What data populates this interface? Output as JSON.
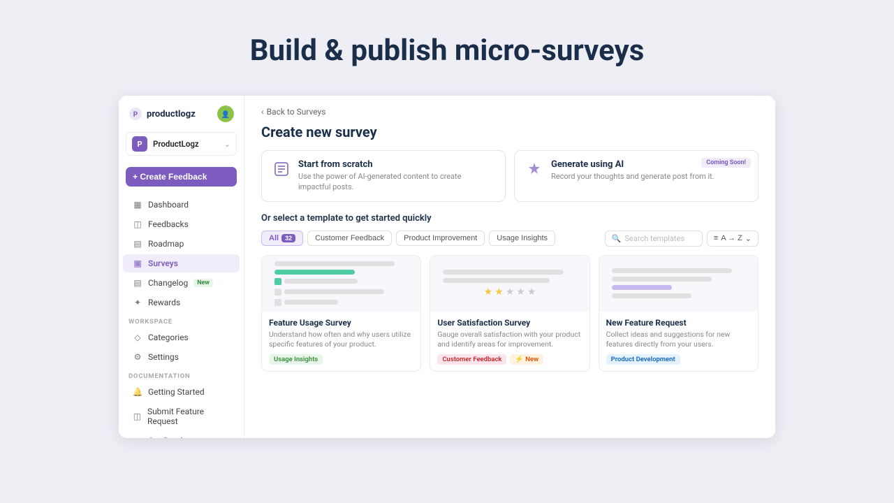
{
  "hero": {
    "title": "Build & publish micro-surveys"
  },
  "sidebar": {
    "logo_text": "productlogz",
    "workspace_name": "ProductLogz",
    "create_button": "+ Create Feedback",
    "nav_items": [
      {
        "id": "dashboard",
        "label": "Dashboard",
        "icon": "▦"
      },
      {
        "id": "feedbacks",
        "label": "Feedbacks",
        "icon": "◫"
      },
      {
        "id": "roadmap",
        "label": "Roadmap",
        "icon": "▤"
      },
      {
        "id": "surveys",
        "label": "Surveys",
        "icon": "▣",
        "active": true
      },
      {
        "id": "changelog",
        "label": "Changelog",
        "icon": "▤",
        "badge": "New"
      },
      {
        "id": "rewards",
        "label": "Rewards",
        "icon": "✦"
      }
    ],
    "workspace_section": "WORKSPACE",
    "workspace_items": [
      {
        "id": "categories",
        "label": "Categories",
        "icon": "◇"
      },
      {
        "id": "settings",
        "label": "Settings",
        "icon": "⚙"
      }
    ],
    "docs_section": "DOCUMENTATION",
    "docs_items": [
      {
        "id": "getting-started",
        "label": "Getting Started",
        "icon": "🔔"
      },
      {
        "id": "submit-feature",
        "label": "Submit Feature Request",
        "icon": "◫"
      },
      {
        "id": "our-roadmap",
        "label": "Our Roadmap",
        "icon": "◫"
      }
    ]
  },
  "main": {
    "back_link": "Back to Surveys",
    "page_title": "Create new survey",
    "options": [
      {
        "id": "scratch",
        "icon": "✏️",
        "title": "Start from scratch",
        "desc": "Use the power of AI-generated content to create impactful posts.",
        "coming_soon": false
      },
      {
        "id": "ai",
        "icon": "✦",
        "title": "Generate using AI",
        "desc": "Record your thoughts and generate post from it.",
        "coming_soon": true,
        "coming_soon_label": "Coming Soon!"
      }
    ],
    "template_section_title": "Or select a template to get started quickly",
    "filters": [
      {
        "id": "all",
        "label": "All",
        "count": "32",
        "active": true
      },
      {
        "id": "customer",
        "label": "Customer Feedback",
        "active": false
      },
      {
        "id": "product",
        "label": "Product Improvement",
        "active": false
      },
      {
        "id": "usage",
        "label": "Usage Insights",
        "active": false
      }
    ],
    "search_placeholder": "Search templates",
    "sort_label": "A → Z",
    "templates": [
      {
        "id": "feature-usage",
        "name": "Feature Usage Survey",
        "desc": "Understand how often and why users utilize specific features of your product.",
        "tag": "Usage Insights",
        "tag_type": "usage",
        "preview_type": "bars_accent"
      },
      {
        "id": "user-satisfaction",
        "name": "User Satisfaction Survey",
        "desc": "Gauge overall satisfaction with your product and identify areas for improvement.",
        "tag": "Customer Feedback",
        "tag_type": "feedback",
        "tag2": "New",
        "tag2_type": "new",
        "preview_type": "stars"
      },
      {
        "id": "new-feature",
        "name": "New Feature Request",
        "desc": "Collect ideas and suggestions for new features directly from your users.",
        "tag": "Product Development",
        "tag_type": "product",
        "preview_type": "bars_accent2"
      }
    ]
  }
}
